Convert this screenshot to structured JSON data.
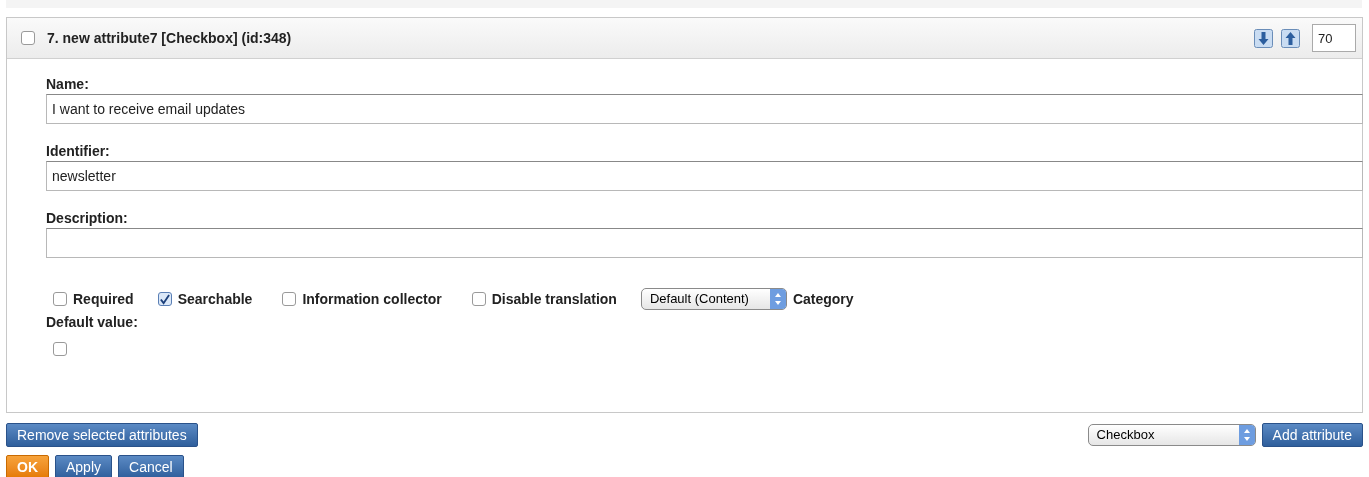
{
  "attribute": {
    "title": "7. new attribute7 [Checkbox] (id:348)",
    "selected": false,
    "priority": "70",
    "fields": [
      {
        "label": "Name:",
        "value": "I want to receive email updates"
      },
      {
        "label": "Identifier:",
        "value": "newsletter"
      },
      {
        "label": "Description:"
      }
    ],
    "options": [
      {
        "kind": "checkbox",
        "label": "Required",
        "checked": false
      },
      {
        "kind": "checkbox",
        "label": "Searchable",
        "checked": true
      },
      {
        "kind": "checkbox",
        "label": "Information collector",
        "checked": false
      },
      {
        "kind": "checkbox",
        "label": "Disable translation",
        "checked": false
      },
      {
        "kind": "select",
        "option": "Default (Content)",
        "label": "Category"
      }
    ],
    "default_value": {
      "label": "Default value:",
      "checked": false
    }
  },
  "remove_button": "Remove selected attributes",
  "add": {
    "type_value": "Checkbox",
    "button": "Add attribute"
  },
  "buttons": [
    {
      "kind": "primary",
      "label": "OK"
    },
    {
      "kind": "default",
      "label": "Apply"
    },
    {
      "kind": "default",
      "label": "Cancel"
    }
  ]
}
